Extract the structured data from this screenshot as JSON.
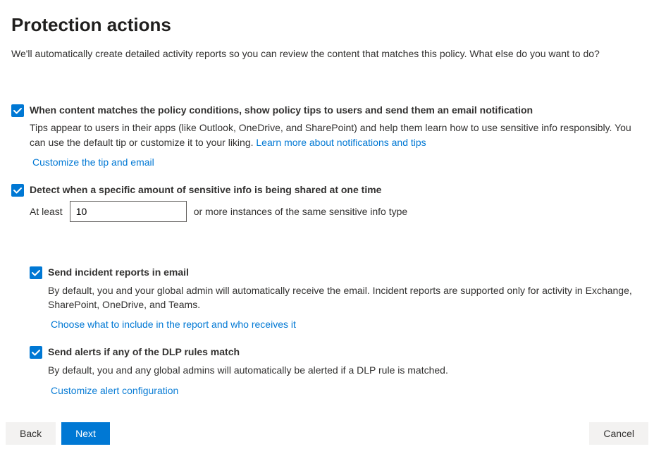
{
  "title": "Protection actions",
  "intro": "We'll automatically create detailed activity reports so you can review the content that matches this policy. What else do you want to do?",
  "options": {
    "policy_tips": {
      "label": "When content matches the policy conditions, show policy tips to users and send them an email notification",
      "desc_prefix": "Tips appear to users in their apps (like Outlook, OneDrive, and SharePoint) and help them learn how to use sensitive info responsibly. You can use the default tip or customize it to your liking. ",
      "learn_more": "Learn more about notifications and tips",
      "customize": "Customize the tip and email"
    },
    "detect_amount": {
      "label": "Detect when a specific amount of sensitive info is being shared at one time",
      "at_least": "At least",
      "value": "10",
      "suffix": "or more instances of the same sensitive info type"
    },
    "incident_reports": {
      "label": "Send incident reports in email",
      "desc": "By default, you and your global admin will automatically receive the email. Incident reports are supported only for activity in Exchange, SharePoint, OneDrive, and Teams.",
      "choose": "Choose what to include in the report and who receives it"
    },
    "alerts": {
      "label": "Send alerts if any of the DLP rules match",
      "desc": "By default, you and any global admins will automatically be alerted if a DLP rule is matched.",
      "customize": "Customize alert configuration"
    }
  },
  "footer": {
    "back": "Back",
    "next": "Next",
    "cancel": "Cancel"
  }
}
